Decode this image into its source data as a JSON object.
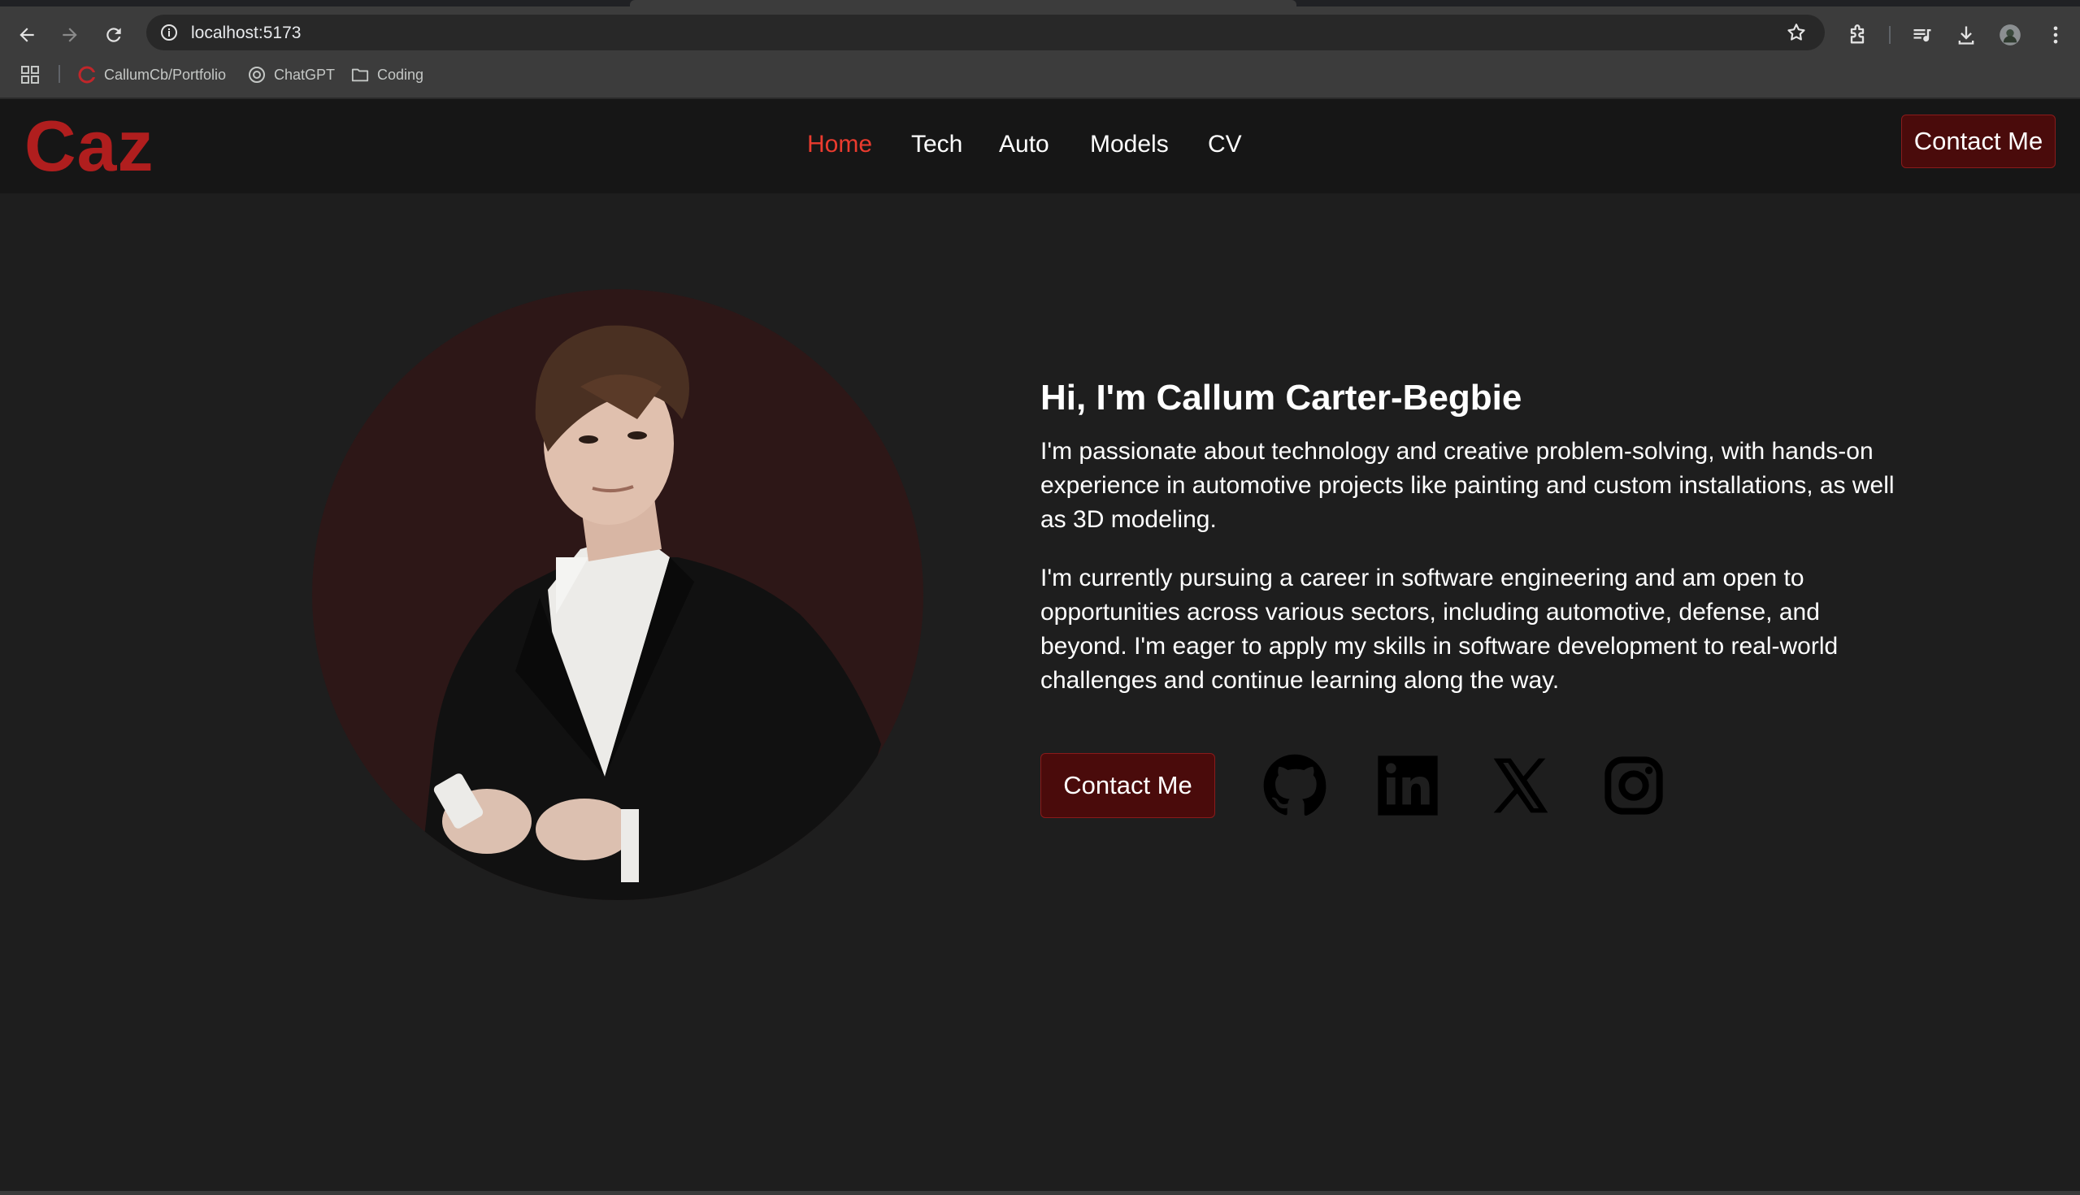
{
  "browser": {
    "url": "localhost:5173",
    "bookmarks": [
      {
        "label": "CallumCb/Portfolio",
        "icon": "red-c-favicon-icon"
      },
      {
        "label": "ChatGPT",
        "icon": "chatgpt-favicon-icon"
      },
      {
        "label": "Coding",
        "icon": "folder-icon"
      }
    ]
  },
  "site": {
    "logo": "Caz",
    "nav": [
      "Home",
      "Tech",
      "Auto",
      "Models",
      "CV"
    ],
    "active_nav": "Home",
    "header_button": "Contact Me",
    "accent_color": "#b01e1e",
    "button_color": "#4a0b0b"
  },
  "hero": {
    "heading": "Hi, I'm Callum Carter-Begbie",
    "paragraph_1": "I'm passionate about technology and creative problem-solving, with hands-on experience in automotive projects like painting and custom installations, as well as 3D modeling.",
    "paragraph_2": "I'm currently pursuing a career in software engineering and am open to opportunities across various sectors, including automotive, defense, and beyond. I'm eager to apply my skills in software development to real-world challenges and continue learning along the way.",
    "contact_button": "Contact Me",
    "social_icons": [
      "github-icon",
      "linkedin-icon",
      "x-icon",
      "instagram-icon"
    ]
  }
}
